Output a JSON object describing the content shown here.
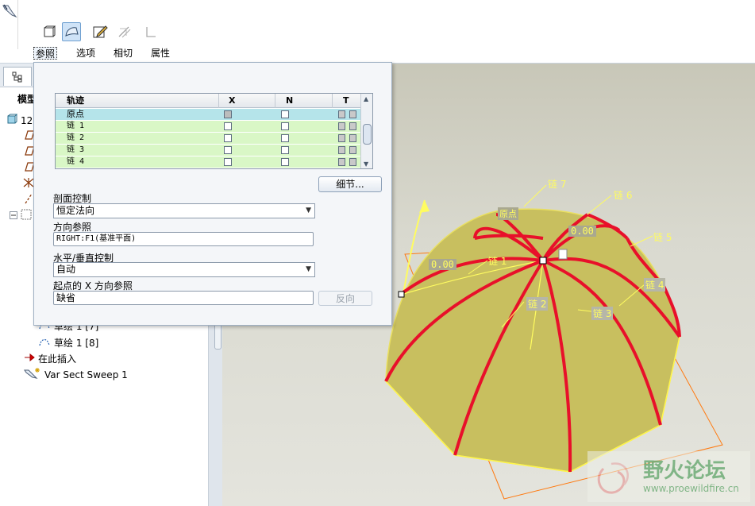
{
  "toolbar": {
    "tabs": [
      "参照",
      "选项",
      "相切",
      "属性"
    ],
    "active_tab": "参照"
  },
  "model_tree": {
    "title": "模型",
    "root_label": "12",
    "items": [
      "草绘 1 [7]",
      "草绘 1 [8]",
      "在此插入",
      "Var Sect Sweep 1"
    ]
  },
  "references": {
    "table": {
      "headers": [
        "轨迹",
        "X",
        "N",
        "T"
      ],
      "rows": [
        "原点",
        "链 1",
        "链 2",
        "链 3",
        "链 4"
      ]
    },
    "details_button": "细节...",
    "section_control_label": "剖面控制",
    "section_control_value": "恒定法向",
    "direction_ref_label": "方向参照",
    "direction_ref_value": "RIGHT:F1(基准平面)",
    "hv_control_label": "水平/垂直控制",
    "hv_control_value": "自动",
    "start_x_label": "起点的 X 方向参照",
    "start_x_value": "缺省",
    "reverse_button": "反向"
  },
  "viewport": {
    "chain_labels": [
      "链 7",
      "链 6",
      "链 5",
      "链 4",
      "链 3",
      "链 2",
      "链 1"
    ],
    "origin_label": "原点",
    "dim_values": [
      "0.00",
      "0.00"
    ],
    "watermark_text": "野火论坛",
    "watermark_url": "www.proewildfire.cn"
  },
  "colors": {
    "surface": "#c8bf5f",
    "trajectory": "#e8102a",
    "dimension": "#ffff80",
    "frame": "#ff7a10"
  }
}
